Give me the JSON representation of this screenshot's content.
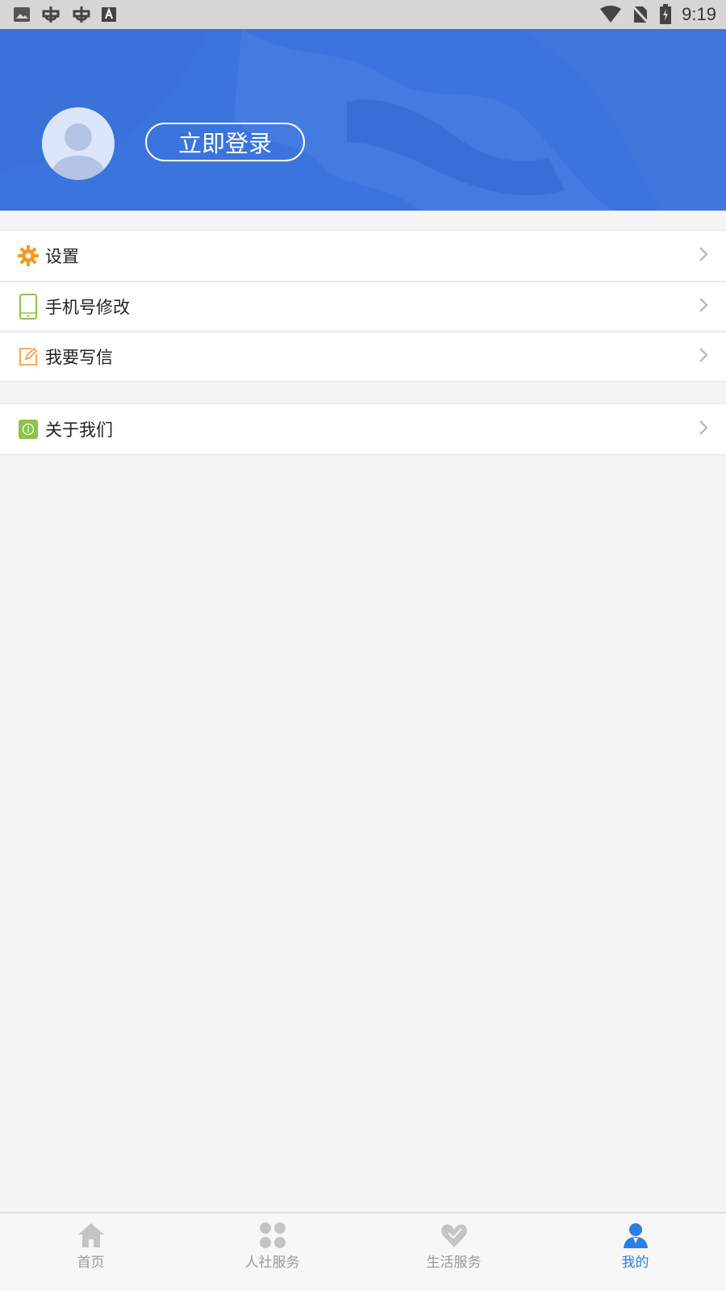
{
  "status_bar": {
    "time": "9:19",
    "left_icons": [
      "image-icon",
      "bug-icon",
      "bug-icon",
      "font-icon"
    ],
    "right_icons": [
      "wifi-icon",
      "no-sim-icon",
      "battery-charging-icon"
    ]
  },
  "header": {
    "login_label": "立即登录",
    "background_color": "#3b74dd"
  },
  "menu": {
    "group1": [
      {
        "label": "设置",
        "icon": "gear-icon",
        "color": "#f39a1e"
      },
      {
        "label": "手机号修改",
        "icon": "phone-icon",
        "color": "#8bc34a"
      },
      {
        "label": "我要写信",
        "icon": "edit-icon",
        "color": "#f0a04b"
      }
    ],
    "group2": [
      {
        "label": "关于我们",
        "icon": "info-icon",
        "color": "#8bc34a"
      }
    ]
  },
  "bottom_nav": {
    "items": [
      {
        "label": "首页",
        "icon": "home-icon",
        "active": false
      },
      {
        "label": "人社服务",
        "icon": "grid-icon",
        "active": false
      },
      {
        "label": "生活服务",
        "icon": "heart-icon",
        "active": false
      },
      {
        "label": "我的",
        "icon": "user-icon",
        "active": true
      }
    ],
    "active_color": "#2d7ee4",
    "inactive_color": "#999999"
  }
}
